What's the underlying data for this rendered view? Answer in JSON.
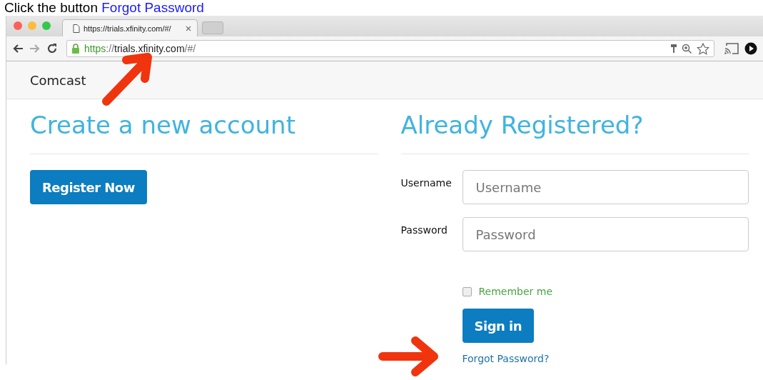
{
  "caption": {
    "text": "Click the button",
    "link": "Forgot Password"
  },
  "browser": {
    "tabs": [
      {
        "title": "https://trials.xfinity.com/#/",
        "selected": true
      }
    ],
    "url_parts": [
      {
        "text": "https",
        "kind": "scheme"
      },
      {
        "text": "://",
        "kind": "dim"
      },
      {
        "text": "trials.xfinity.com",
        "kind": "host"
      },
      {
        "text": "/#/",
        "kind": "dim"
      }
    ]
  },
  "header": {
    "brand": "Comcast"
  },
  "register": {
    "heading": "Create a new account",
    "button": "Register Now"
  },
  "login": {
    "heading": "Already Registered?",
    "fields": [
      {
        "label": "Username",
        "placeholder": "Username"
      },
      {
        "label": "Password",
        "placeholder": "Password"
      }
    ],
    "remember": {
      "label": "Remember me",
      "checked": false
    },
    "button": "Sign in",
    "link": "Forgot Password?"
  }
}
